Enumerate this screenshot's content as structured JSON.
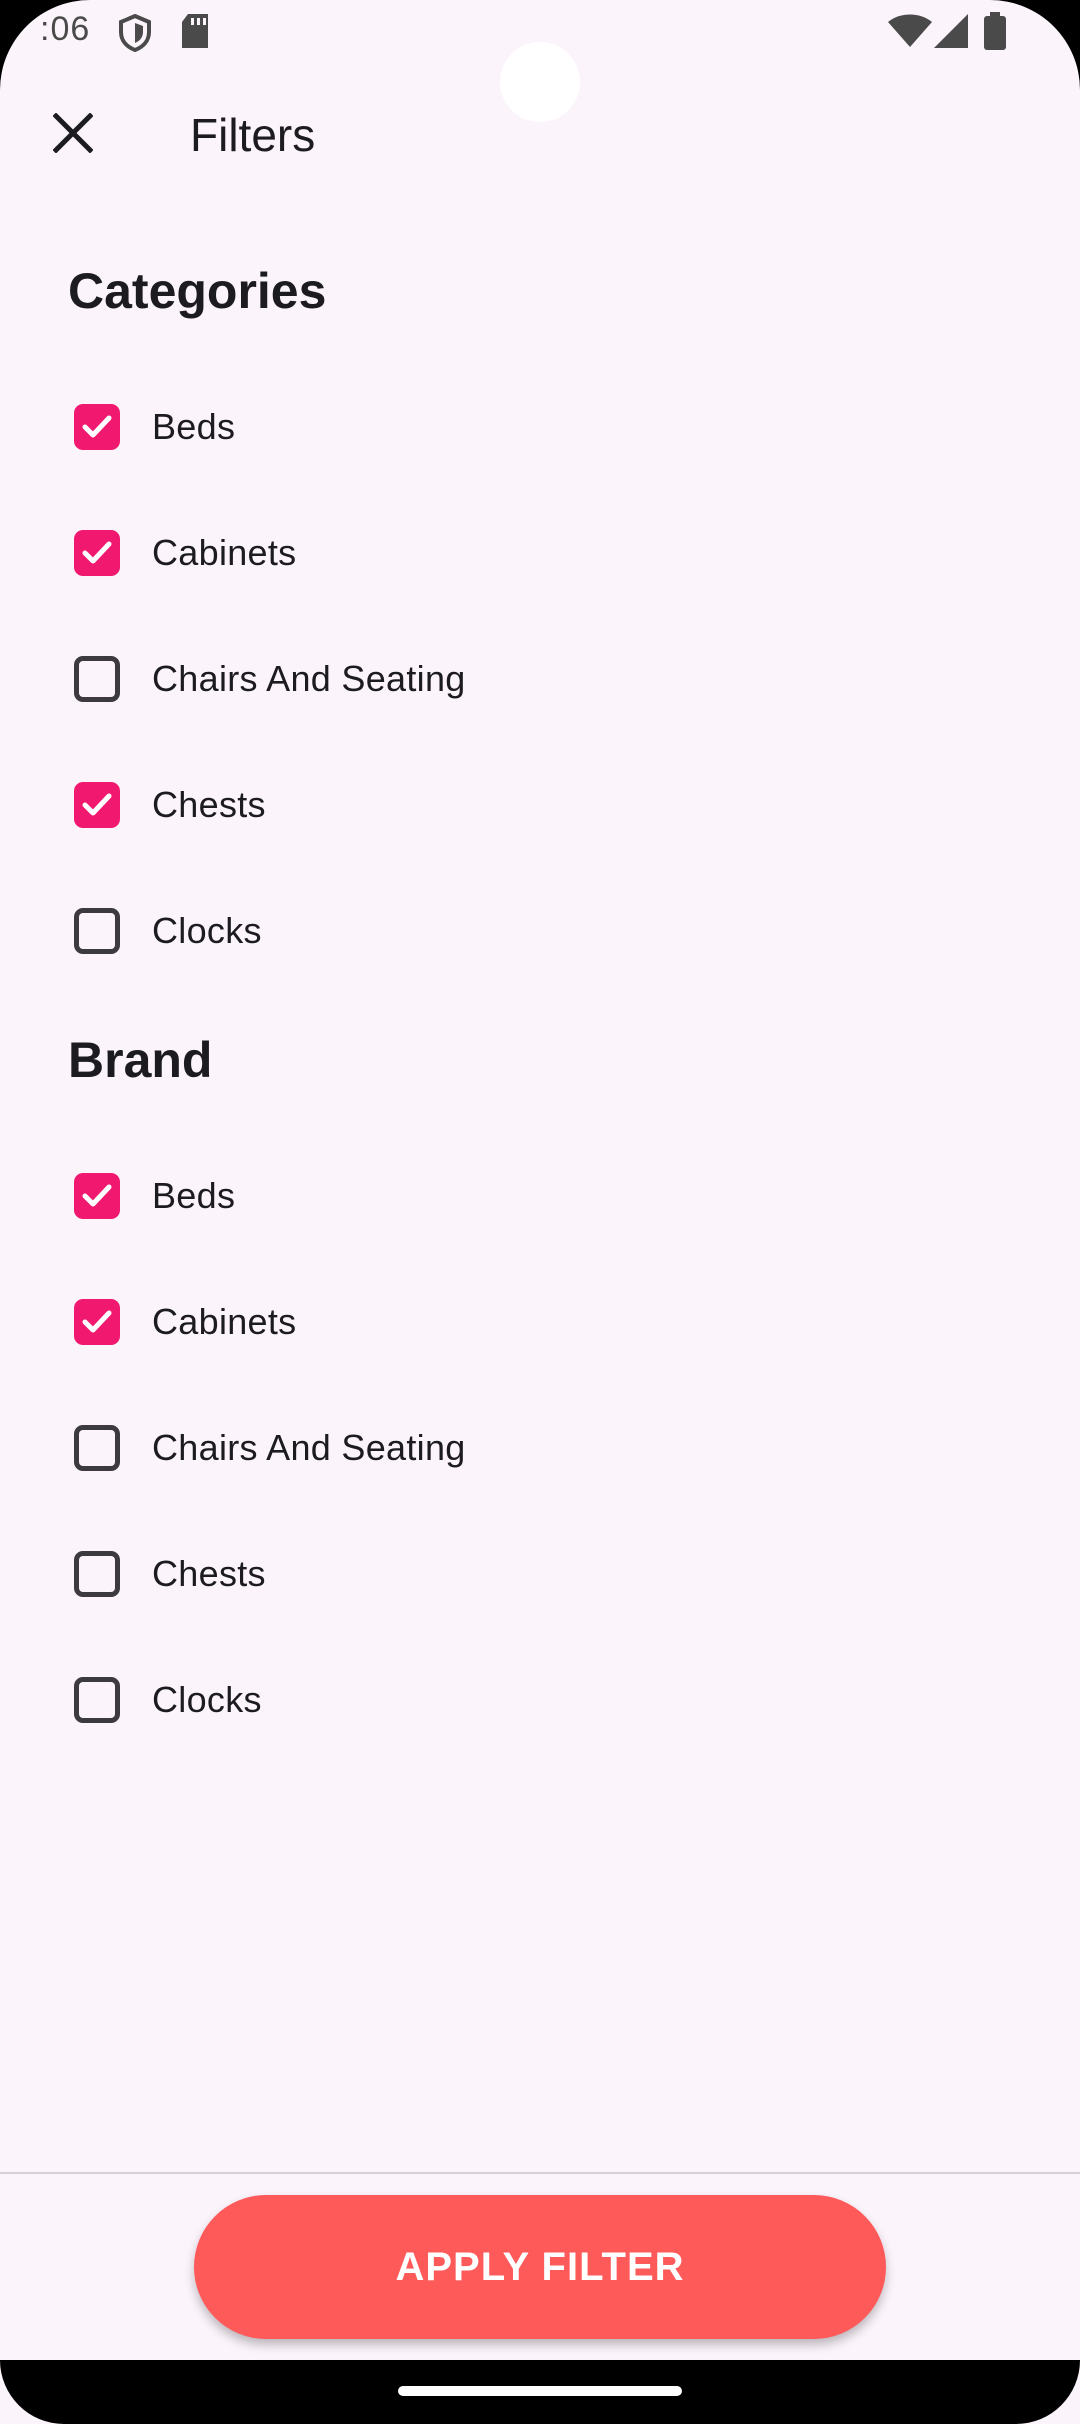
{
  "status_bar": {
    "time": ":06",
    "icons": [
      "shield-icon",
      "sd-card-icon",
      "wifi-icon",
      "signal-icon",
      "battery-icon"
    ]
  },
  "toolbar": {
    "close_icon": "close-icon",
    "title": "Filters"
  },
  "categories": {
    "heading": "Categories",
    "items": [
      {
        "label": "Beds",
        "checked": true
      },
      {
        "label": "Cabinets",
        "checked": true
      },
      {
        "label": "Chairs And Seating",
        "checked": false
      },
      {
        "label": "Chests",
        "checked": true
      },
      {
        "label": "Clocks",
        "checked": false
      }
    ]
  },
  "brand": {
    "heading": "Brand",
    "items": [
      {
        "label": "Beds",
        "checked": true
      },
      {
        "label": "Cabinets",
        "checked": true
      },
      {
        "label": "Chairs And Seating",
        "checked": false
      },
      {
        "label": "Chests",
        "checked": false
      },
      {
        "label": "Clocks",
        "checked": false
      }
    ]
  },
  "footer": {
    "apply_label": "APPLY FILTER"
  },
  "colors": {
    "background": "#FCF4FB",
    "checkbox_checked": "#F0196F",
    "apply_button": "#FF5A5A"
  }
}
